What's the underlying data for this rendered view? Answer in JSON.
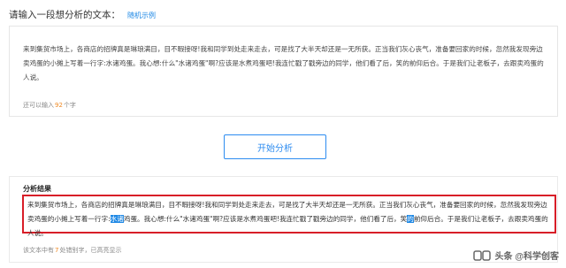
{
  "prompt": {
    "title": "请输入一段想分析的文本：",
    "random_example_label": "随机示例"
  },
  "input": {
    "text": "来到集贸市场上，各商店的招牌真是琳琅满目，目不暇接呀!我和同学到处走来走去，可是找了大半天却还是一无所获。正当我们灰心丧气，准备要回家的时候，忽然我发现旁边卖鸡蛋的小摊上写着一行字:水诸鸡蛋。我心想:什么\"水诸鸡蛋\"啊?应该是水煮鸡蛋吧!我连忙戳了戳旁边的同学，他们看了后，笑的前仰后合。于是我们让老板子，去跟卖鸡蛋的人说。",
    "remain_prefix": "还可以输入",
    "remain_count": "92",
    "remain_suffix": "个字"
  },
  "analyze_button": {
    "label": "开始分析"
  },
  "result": {
    "title": "分析结果",
    "text_before_hl1": "来到集贸市场上，各商店的招牌真是琳琅满目，目不暇接呀!我和同学到处走来走去，可是找了大半天却还是一无所获。正当我们灰心丧气，准备要回家的时候，忽然我发现旁边卖鸡蛋的小摊上写着一行字:",
    "hl1": "水诸",
    "text_after_hl1": "鸡蛋。我心想:什么\"水诸鸡蛋\"啊?应该是水煮鸡蛋吧!我连忙戳了戳旁边的同学，他们看了后，笑",
    "hl2": "的",
    "text_after_hl2": "前仰后合。于是我们让老板子，去跟卖鸡蛋的人说。",
    "error_prefix": "该文本中有",
    "error_count": "7",
    "error_suffix": "处错别字，已高亮显示"
  },
  "watermark": {
    "text": "头条 @科学创客"
  },
  "colors": {
    "accent": "#2d8cf0",
    "highlight": "#1e88e5",
    "result_border": "#d81e28",
    "count": "#f08a24"
  }
}
